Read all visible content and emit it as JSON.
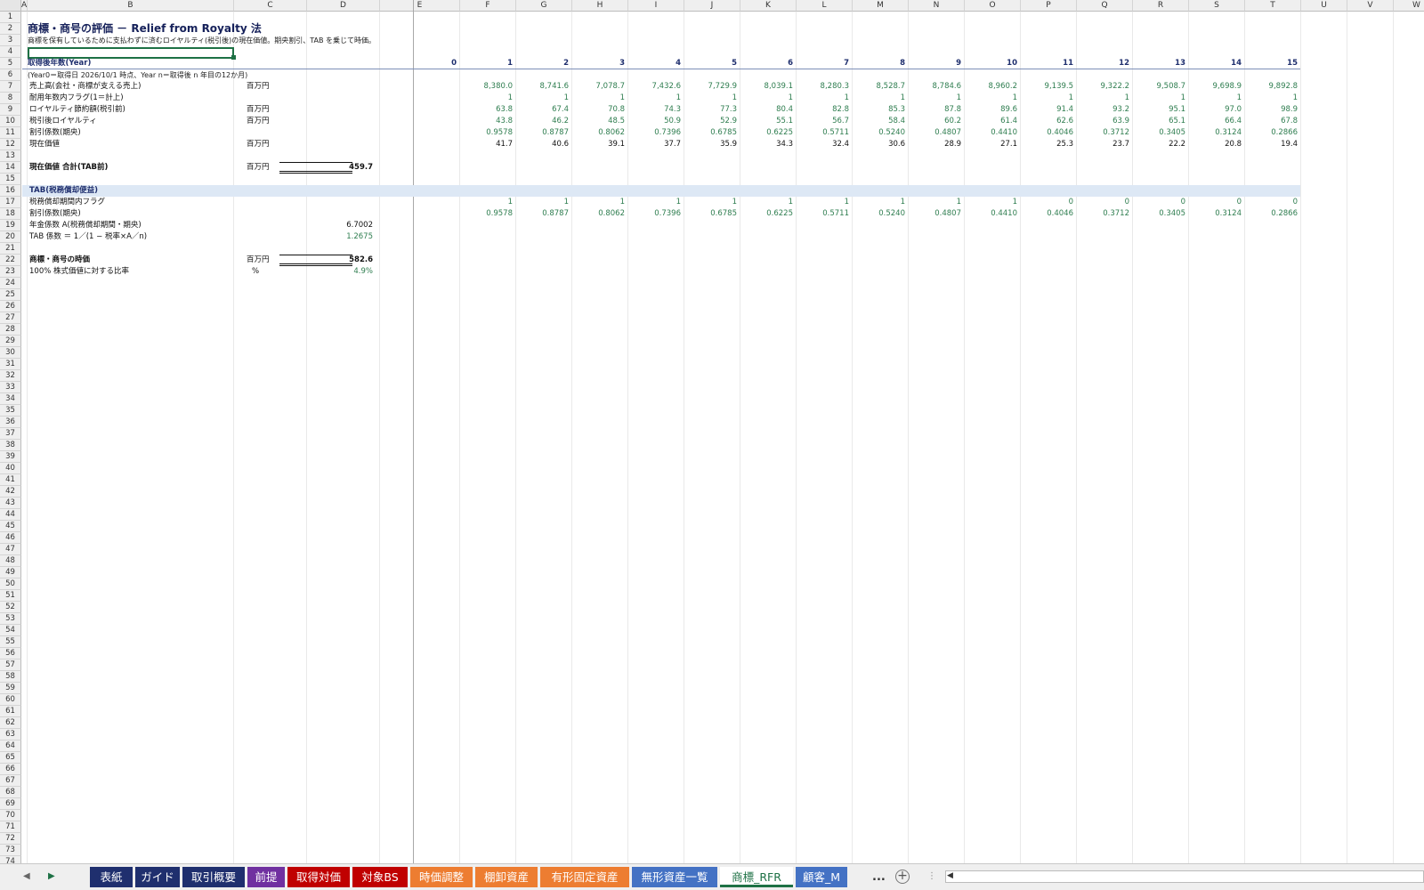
{
  "columns": [
    "A",
    "B",
    "C",
    "D",
    "E",
    "F",
    "G",
    "H",
    "I",
    "J",
    "K",
    "L",
    "M",
    "N",
    "O",
    "P",
    "Q",
    "R",
    "S",
    "T",
    "U",
    "V",
    "W"
  ],
  "row_count": 74,
  "title": "商標・商号の評価 － Relief from Royalty 法",
  "subtitle": "商標を保有しているために支払わずに済むロイヤルティ(税引後)の現在価値。期央割引、TAB を乗じて時価。",
  "year_header": {
    "label": "取得後年数(Year)",
    "years": [
      "0",
      "1",
      "2",
      "3",
      "4",
      "5",
      "6",
      "7",
      "8",
      "9",
      "10",
      "11",
      "12",
      "13",
      "14",
      "15"
    ]
  },
  "year_note": "(Year0＝取得日 2026/10/1 時点、Year n＝取得後 n 年目の12か月)",
  "rows": [
    {
      "row": 7,
      "label": "売上高(会社・商標が支える売上)",
      "unit": "百万円",
      "values": [
        "8,380.0",
        "8,741.6",
        "7,078.7",
        "7,432.6",
        "7,729.9",
        "8,039.1",
        "8,280.3",
        "8,528.7",
        "8,784.6",
        "8,960.2",
        "9,139.5",
        "9,322.2",
        "9,508.7",
        "9,698.9",
        "9,892.8"
      ]
    },
    {
      "row": 8,
      "label": "耐用年数内フラグ(1＝計上)",
      "unit": "",
      "values": [
        "1",
        "1",
        "1",
        "1",
        "1",
        "1",
        "1",
        "1",
        "1",
        "1",
        "1",
        "1",
        "1",
        "1",
        "1"
      ]
    },
    {
      "row": 9,
      "label": "ロイヤルティ節約額(税引前)",
      "unit": "百万円",
      "values": [
        "63.8",
        "67.4",
        "70.8",
        "74.3",
        "77.3",
        "80.4",
        "82.8",
        "85.3",
        "87.8",
        "89.6",
        "91.4",
        "93.2",
        "95.1",
        "97.0",
        "98.9"
      ]
    },
    {
      "row": 10,
      "label": "税引後ロイヤルティ",
      "unit": "百万円",
      "values": [
        "43.8",
        "46.2",
        "48.5",
        "50.9",
        "52.9",
        "55.1",
        "56.7",
        "58.4",
        "60.2",
        "61.4",
        "62.6",
        "63.9",
        "65.1",
        "66.4",
        "67.8"
      ]
    },
    {
      "row": 11,
      "label": "割引係数(期央)",
      "unit": "",
      "values": [
        "0.9578",
        "0.8787",
        "0.8062",
        "0.7396",
        "0.6785",
        "0.6225",
        "0.5711",
        "0.5240",
        "0.4807",
        "0.4410",
        "0.4046",
        "0.3712",
        "0.3405",
        "0.3124",
        "0.2866"
      ]
    },
    {
      "row": 12,
      "label": "現在価値",
      "unit": "百万円",
      "values": [
        "41.7",
        "40.6",
        "39.1",
        "37.7",
        "35.9",
        "34.3",
        "32.4",
        "30.6",
        "28.9",
        "27.1",
        "25.3",
        "23.7",
        "22.2",
        "20.8",
        "19.4"
      ]
    }
  ],
  "pv_total": {
    "label": "現在価値 合計(TAB前)",
    "unit": "百万円",
    "value": "459.7"
  },
  "tab_section": {
    "label": "TAB(税務償却便益)",
    "flag_row": {
      "label": "税務償却期間内フラグ",
      "values": [
        "1",
        "1",
        "1",
        "1",
        "1",
        "1",
        "1",
        "1",
        "1",
        "1",
        "0",
        "0",
        "0",
        "0",
        "0"
      ]
    },
    "discount_row": {
      "label": "割引係数(期央)",
      "values": [
        "0.9578",
        "0.8787",
        "0.8062",
        "0.7396",
        "0.6785",
        "0.6225",
        "0.5711",
        "0.5240",
        "0.4807",
        "0.4410",
        "0.4046",
        "0.3712",
        "0.3405",
        "0.3124",
        "0.2866"
      ]
    },
    "annuity": {
      "label": "年金係数 A(税務償却期間・期央)",
      "value": "6.7002"
    },
    "tab_factor": {
      "label": "TAB 係数 ＝ 1／(1 − 税率×A／n)",
      "value": "1.2675"
    }
  },
  "fair_value": {
    "label": "商標・商号の時価",
    "unit": "百万円",
    "value": "582.6"
  },
  "ratio": {
    "label": "100% 株式価値に対する比率",
    "unit": "%",
    "value": "4.9%"
  },
  "sheet_tabs": [
    {
      "label": "表紙",
      "color": "#1f2f6e"
    },
    {
      "label": "ガイド",
      "color": "#1f2f6e"
    },
    {
      "label": "取引概要",
      "color": "#1f2f6e"
    },
    {
      "label": "前提",
      "color": "#7030a0"
    },
    {
      "label": "取得対価",
      "color": "#c00000"
    },
    {
      "label": "対象BS",
      "color": "#c00000"
    },
    {
      "label": "時価調整",
      "color": "#ed7d31"
    },
    {
      "label": "棚卸資産",
      "color": "#ed7d31"
    },
    {
      "label": "有形固定資産",
      "color": "#ed7d31"
    },
    {
      "label": "無形資産一覧",
      "color": "#4472c4"
    },
    {
      "label": "商標_RFR",
      "color": "#ffffff",
      "active": true
    },
    {
      "label": "顧客_M",
      "color": "#4472c4"
    }
  ],
  "tab_more": "...",
  "tab_add": "+"
}
